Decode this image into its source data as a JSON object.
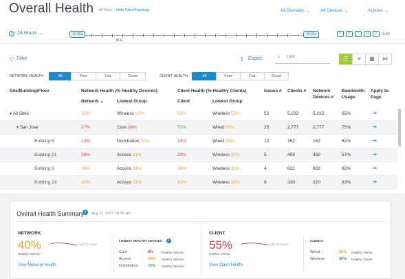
{
  "header": {
    "title": "Overall Health",
    "all_sites": "All Sites",
    "hide_sites": "Hide Sites/Topology",
    "all_domains": "All Domains",
    "all_devices": "All Devices",
    "actions": "Actions"
  },
  "timeline": {
    "range": "24 Hours",
    "start_label": "10:00a",
    "end_label": "10:00a",
    "date": "8/11",
    "end_time": "4:59"
  },
  "toolbar": {
    "filter": "Filter",
    "export": "Export",
    "find_placeholder": "Find"
  },
  "network_health": {
    "label": "NETWORK HEALTH",
    "options": [
      "All",
      "Poor",
      "Fair",
      "Good"
    ],
    "selected": "All"
  },
  "client_health": {
    "label": "CLIENT HEALTH",
    "options": [
      "All",
      "Poor",
      "Fair",
      "Good"
    ],
    "selected": "All"
  },
  "table": {
    "headers": {
      "site": "Site/Building/Floor",
      "network_health": "Network Health (% Healthy Devices)",
      "client_health": "Client Health (% Healthy Clients)",
      "issues": "Issues #",
      "clients": "Clients #",
      "network_devices": "Network Devices #",
      "bandwidth": "Bandwidth Usage",
      "apply": "Apply to Page"
    },
    "subheaders": {
      "network": "Network",
      "lowest_group_1": "Lowest Group",
      "client": "Client",
      "lowest_group_2": "Lowest Group"
    },
    "rows": [
      {
        "site": "All Sites",
        "net": "52%",
        "net_group": "Wireless",
        "net_group_pct": "52%",
        "client": "52%",
        "client_group": "Wireless",
        "client_group_pct": "52%",
        "issues": "52",
        "clients": "5,232",
        "devices": "5,232",
        "bandwidth": "65%"
      },
      {
        "site": "San Jose",
        "net": "27%",
        "net_group": "Core",
        "net_group_pct": "24%",
        "client": "72%",
        "client_group": "Wired",
        "client_group_pct": "56%",
        "issues": "25",
        "clients": "2,777",
        "devices": "2,777",
        "bandwidth": "75%"
      },
      {
        "site": "Building 5",
        "net": "13%",
        "net_group": "Distribution",
        "net_group_pct": "31%",
        "client": "13%",
        "client_group": "Wired",
        "client_group_pct": "31%",
        "issues": "12",
        "clients": "162",
        "devices": "162",
        "bandwidth": "62%"
      },
      {
        "site": "Building 21",
        "net": "29%",
        "net_group": "Access",
        "net_group_pct": "31%",
        "client": "29%",
        "client_group": "Wireless",
        "client_group_pct": "31%",
        "issues": "5",
        "clients": "459",
        "devices": "459",
        "bandwidth": "57%"
      },
      {
        "site": "Building 3",
        "net": "38%",
        "net_group": "Access",
        "net_group_pct": "31%",
        "client": "38%",
        "client_group": "Wireless",
        "client_group_pct": "31%",
        "issues": "4",
        "clients": "622",
        "devices": "622",
        "bandwidth": "62%"
      },
      {
        "site": "Building 23",
        "net": "42%",
        "net_group": "Access",
        "net_group_pct": "31%",
        "client": "42%",
        "client_group": "Wireless",
        "client_group_pct": "31%",
        "issues": "8",
        "clients": "320",
        "devices": "320",
        "bandwidth": "63%"
      }
    ]
  },
  "summary": {
    "title": "Overall Health Summary",
    "date": "Aug 11, 2017 10:06 am",
    "network": {
      "title": "NETWORK",
      "pct": "40%",
      "caption": "Healthy Devices",
      "spark_label": "Last 24 hours",
      "link": "View Network Health"
    },
    "lowest": {
      "title": "LOWEST HEALTHY DEVICES",
      "rows": [
        {
          "name": "Core",
          "pct": "8%",
          "tail": "Healthy Devices"
        },
        {
          "name": "Access",
          "pct": "30%",
          "tail": "Healthy Devices"
        },
        {
          "name": "Distribution",
          "pct": "72%",
          "tail": "Healthy Devices"
        }
      ]
    },
    "client": {
      "title": "CLIENT",
      "pct": "55%",
      "caption": "Healthy Clients",
      "spark_label": "Last 24 hours",
      "link": "View Client Health"
    },
    "clients": {
      "title": "CLIENTS",
      "rows": [
        {
          "name": "Wired",
          "pct": "30%",
          "tail": "Healthy Clients"
        },
        {
          "name": "Wireless",
          "pct": "80%",
          "tail": "Healthy Clients"
        }
      ]
    }
  },
  "colors": {
    "accent": "#1b8bd0",
    "good": "#3aa54a",
    "fair": "#f0a22a",
    "poor": "#e0394a",
    "view_active": "#a4cc3a"
  }
}
